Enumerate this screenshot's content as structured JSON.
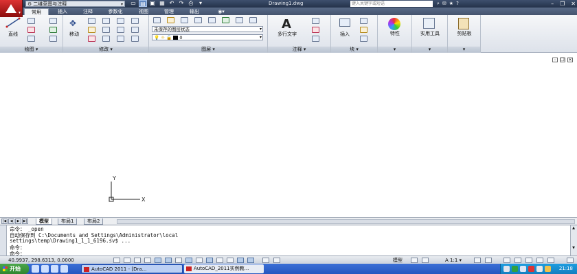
{
  "titlebar": {
    "workspace": "二维草图与注释",
    "document_title": "Drawing1.dwg",
    "search_placeholder": "键入关键字或短语"
  },
  "ribbon_tabs": [
    "常用",
    "插入",
    "注释",
    "参数化",
    "视图",
    "管理",
    "输出"
  ],
  "ribbon": {
    "draw": {
      "line_label": "直线",
      "panel_title": "绘图"
    },
    "modify": {
      "move_label": "移动",
      "panel_title": "修改"
    },
    "layers": {
      "layer_state": "未保存的图层状态",
      "current_layer": "0",
      "panel_title": "图层"
    },
    "annotation": {
      "mtext_label": "多行文字",
      "panel_title": "注释"
    },
    "block": {
      "insert_label": "插入",
      "panel_title": "块"
    },
    "properties": {
      "label": "特性"
    },
    "utilities": {
      "label": "实用工具"
    },
    "clipboard": {
      "label": "剪贴板"
    }
  },
  "ucs": {
    "x_label": "X",
    "y_label": "Y"
  },
  "layout_tabs": [
    "模型",
    "布局1",
    "布局2"
  ],
  "command_lines": [
    "命令： _open",
    "自动保存到 C:\\Documents and Settings\\Administrator\\local",
    "settings\\temp\\Drawing1_1_1_6196.sv$ ...",
    "命令：",
    "命令："
  ],
  "statusbar": {
    "coordinates": "40.9937,  298.6313,  0.0000",
    "model_label": "模型",
    "scale": "1:1"
  },
  "taskbar": {
    "start_label": "开始",
    "tasks": [
      "AutoCAD 2011 - [Dra...",
      "AutoCAD_2011实例教..."
    ],
    "clock": "21:18"
  }
}
